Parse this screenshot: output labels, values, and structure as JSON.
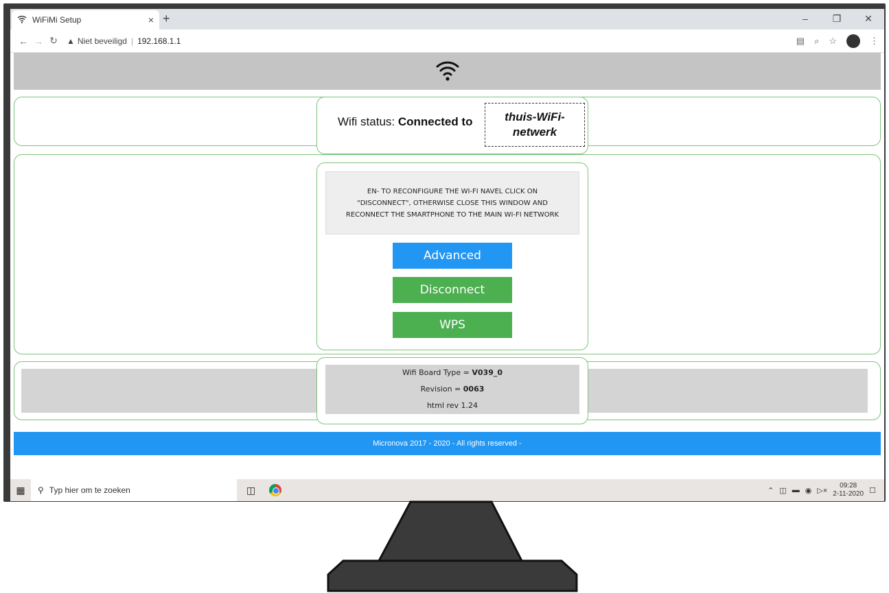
{
  "browser": {
    "tab_title": "WiFiMi Setup",
    "tab_close": "×",
    "new_tab": "+",
    "security_label": "Niet beveiligd",
    "url": "192.168.1.1"
  },
  "page": {
    "wifi_status_label": "Wifi status:",
    "wifi_status_value": "Connected to",
    "ssid": "thuis-WiFi-netwerk",
    "message": "EN- TO RECONFIGURE THE WI-FI NAVEL CLICK ON \"DISCONNECT\", OTHERWISE CLOSE THIS WINDOW AND RECONNECT THE SMARTPHONE TO THE MAIN WI-FI NETWORK",
    "buttons": {
      "advanced": "Advanced",
      "disconnect": "Disconnect",
      "wps": "WPS"
    },
    "info": {
      "board_label": "Wifi Board Type = ",
      "board_value": "V039_0",
      "revision_label": "Revision = ",
      "revision_value": "0063",
      "html_rev": "html rev 1.24"
    },
    "footer": "Micronova 2017 - 2020 - All rights reserved -"
  },
  "taskbar": {
    "search_placeholder": "Typ hier om te zoeken",
    "time": "09:28",
    "date": "2-11-2020"
  },
  "colors": {
    "primary_button": "#2196f3",
    "success_button": "#4caf50",
    "panel_border": "#7ac47a",
    "header_gray": "#c4c4c4"
  }
}
